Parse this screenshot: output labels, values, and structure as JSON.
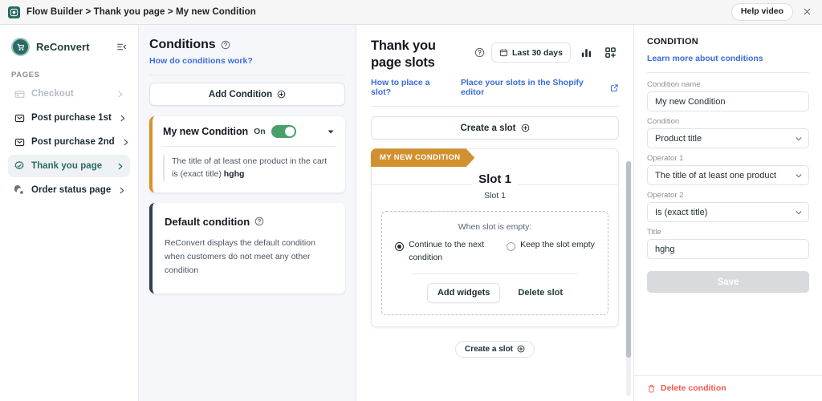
{
  "topbar": {
    "logo_icon": "reconvert-logo-icon",
    "breadcrumb": "Flow Builder > Thank you page > My new Condition",
    "help_label": "Help video",
    "close_icon": "close-icon"
  },
  "sidebar": {
    "brand": "ReConvert",
    "brand_icon": "shopping-cart-icon",
    "collapse_icon": "collapse-sidebar-icon",
    "section_label": "PAGES",
    "items": [
      {
        "label": "Checkout",
        "icon": "checkout-icon",
        "state": "disabled"
      },
      {
        "label": "Post purchase 1st",
        "icon": "envelope-icon",
        "state": "normal"
      },
      {
        "label": "Post purchase 2nd",
        "icon": "envelope-icon",
        "state": "normal"
      },
      {
        "label": "Thank you page",
        "icon": "check-badge-icon",
        "state": "active"
      },
      {
        "label": "Order status page",
        "icon": "order-status-icon",
        "state": "normal"
      }
    ]
  },
  "conditions": {
    "title": "Conditions",
    "help_icon": "question-circle-icon",
    "help_link": "How do conditions work?",
    "add_button": "Add Condition",
    "add_icon": "plus-circle-icon",
    "card": {
      "name": "My new Condition",
      "toggle_label": "On",
      "toggle_state": "on",
      "caret_icon": "caret-down-icon",
      "description_prefix": "The title of at least one product in the cart is (exact title) ",
      "description_value": "hghg",
      "accent_color": "#d99127"
    },
    "default_card": {
      "title": "Default condition",
      "help_icon": "question-circle-icon",
      "text": "ReConvert displays the default condition when customers do not meet any other condition",
      "accent_color": "#2f3e55"
    }
  },
  "center": {
    "heading": "Thank you\npage slots",
    "help_icon": "question-circle-icon",
    "date_range": "Last 30 days",
    "calendar_icon": "calendar-icon",
    "analytics_icon": "bar-chart-icon",
    "apps_icon": "add-widget-grid-icon",
    "link_place": "How to place a slot?",
    "link_editor": "Place your slots in the Shopify editor",
    "external_icon": "external-link-icon",
    "create_slot": "Create a slot",
    "create_icon": "plus-circle-icon",
    "slot": {
      "ribbon": "MY NEW CONDITION",
      "title": "Slot 1",
      "subtitle": "Slot 1",
      "empty_title": "When slot is empty:",
      "radio_1": "Continue to the next condition",
      "radio_1_state": "selected",
      "radio_2": "Keep the slot empty",
      "radio_2_state": "unselected",
      "add_widgets": "Add widgets",
      "delete_slot": "Delete slot"
    },
    "create_slot_bottom": "Create a slot",
    "create_slot_bottom_icon": "plus-circle-icon"
  },
  "right": {
    "title": "CONDITION",
    "learn_link": "Learn more about conditions",
    "fields": [
      {
        "label": "Condition name",
        "type": "text",
        "value": "My new Condition"
      },
      {
        "label": "Condition",
        "type": "select",
        "value": "Product title"
      },
      {
        "label": "Operator 1",
        "type": "select",
        "value": "The title of at least one product"
      },
      {
        "label": "Operator 2",
        "type": "select",
        "value": "Is (exact title)"
      },
      {
        "label": "Title",
        "type": "text",
        "value": "hghg"
      }
    ],
    "save_label": "Save",
    "save_disabled": true,
    "delete_label": "Delete condition",
    "delete_icon": "trash-icon",
    "delete_color": "#f4584f"
  }
}
